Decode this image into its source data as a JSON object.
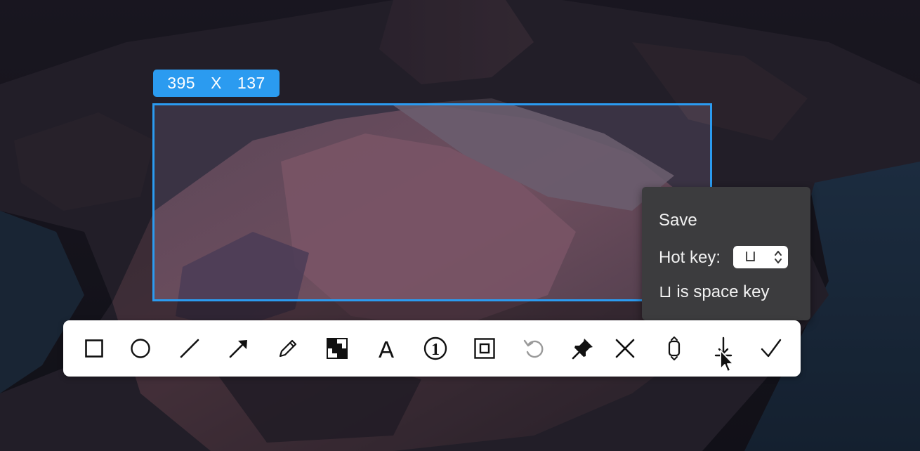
{
  "selection": {
    "width_label": "395",
    "separator": "X",
    "height_label": "137"
  },
  "toolbar": {
    "tools": [
      {
        "name": "rectangle-tool",
        "icon": "square-icon"
      },
      {
        "name": "ellipse-tool",
        "icon": "circle-icon"
      },
      {
        "name": "line-tool",
        "icon": "line-icon"
      },
      {
        "name": "arrow-tool",
        "icon": "arrow-icon"
      },
      {
        "name": "pencil-tool",
        "icon": "pencil-icon"
      },
      {
        "name": "mosaic-tool",
        "icon": "mosaic-icon"
      },
      {
        "name": "text-tool",
        "icon": "text-icon"
      },
      {
        "name": "number-tool",
        "icon": "numbered-circle-icon"
      },
      {
        "name": "border-tool",
        "icon": "nested-square-icon"
      },
      {
        "name": "undo-button",
        "icon": "undo-icon"
      },
      {
        "name": "pin-button",
        "icon": "pushpin-icon"
      },
      {
        "name": "cancel-button",
        "icon": "close-icon"
      },
      {
        "name": "ocr-button",
        "icon": "text-scan-icon"
      },
      {
        "name": "save-button",
        "icon": "download-icon"
      },
      {
        "name": "confirm-button",
        "icon": "checkmark-icon"
      }
    ],
    "text_glyph": "A",
    "number_glyph": "①"
  },
  "save_popover": {
    "title": "Save",
    "hotkey_label": "Hot key:",
    "hotkey_value": "⊔",
    "space_note": "⊔ is space key"
  },
  "colors": {
    "accent": "#2b9bf0",
    "popover_bg": "#3c3c3e",
    "toolbar_bg": "#ffffff",
    "icon": "#111111",
    "icon_disabled": "#9a9a9a"
  }
}
